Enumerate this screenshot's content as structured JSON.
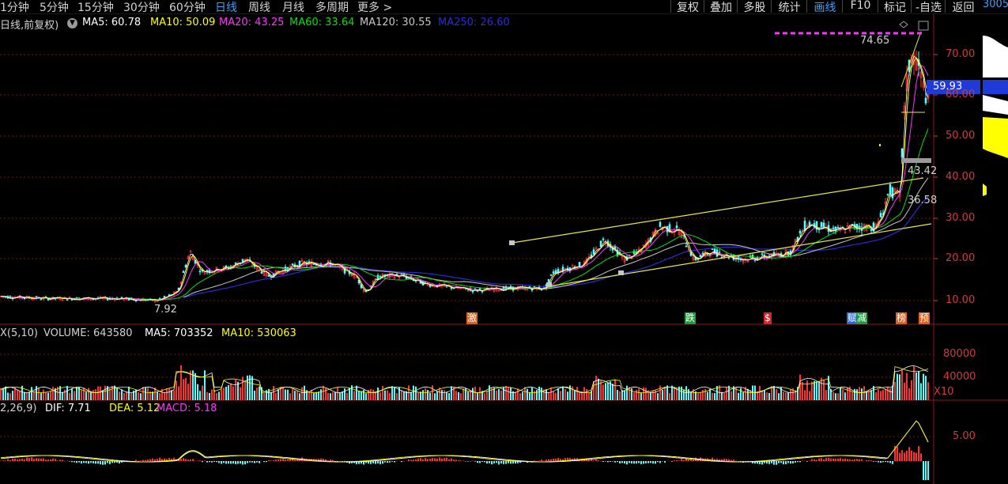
{
  "periods": [
    "1分钟",
    "5分钟",
    "15分钟",
    "30分钟",
    "60分钟",
    "日线",
    "周线",
    "月线",
    "多周期",
    "更多 >"
  ],
  "active_period": "日线",
  "toolbar": [
    "复权",
    "叠加",
    "多股",
    "统计",
    "画线",
    "F10",
    "标记",
    "-自选",
    "返回"
  ],
  "corner_text": "3005",
  "main": {
    "title": "日线,前复权)",
    "ma": [
      {
        "label": "MA5: 60.78",
        "color": "#ffffff"
      },
      {
        "label": "MA10: 50.09",
        "color": "#ffff00"
      },
      {
        "label": "MA20: 43.25",
        "color": "#ff33ff"
      },
      {
        "label": "MA60: 33.64",
        "color": "#00e000"
      },
      {
        "label": "MA120: 30.55",
        "color": "#c8c8c8"
      },
      {
        "label": "MA250: 26.60",
        "color": "#2b2bd6"
      }
    ],
    "y_ticks": [
      "70.00",
      "60.00",
      "50.00",
      "40.00",
      "30.00",
      "20.00",
      "10.00"
    ],
    "current_price": "59.93",
    "high_label": "74.65",
    "low_label": "7.92",
    "label_43": "43.42",
    "label_36": "36.58",
    "event_tags": [
      {
        "text": "激",
        "color": "#e0601a"
      },
      {
        "text": "跌",
        "color": "#1aa03a"
      },
      {
        "text": "$",
        "color": "#e02020"
      },
      {
        "text": "赋",
        "color": "#2a6ad0"
      },
      {
        "text": "减",
        "color": "#1aa03a"
      },
      {
        "text": "榜",
        "color": "#e0601a"
      },
      {
        "text": "预",
        "color": "#e0601a"
      }
    ]
  },
  "volume": {
    "label_prefix": "X(5,10)",
    "volume": "VOLUME: 643580",
    "ma5": "MA5: 703352",
    "ma10": "MA10: 530063",
    "y_ticks": [
      "80000",
      "40000"
    ],
    "unit": "X10"
  },
  "macd": {
    "label_prefix": "2,26,9)",
    "dif": "DIF: 7.71",
    "dea": "DEA: 5.12",
    "macd": "MACD: 5.18",
    "y_ticks": [
      "5.00"
    ]
  },
  "colors": {
    "up": "#ff3232",
    "down": "#54ffff",
    "grid": "#7a1414",
    "axis_text": "#d23a3a",
    "ma5": "#ffffff",
    "ma10": "#ffff00",
    "ma20": "#ff33ff",
    "ma60": "#00e000",
    "ma120": "#c8c8c8",
    "ma250": "#2b2bd6"
  }
}
